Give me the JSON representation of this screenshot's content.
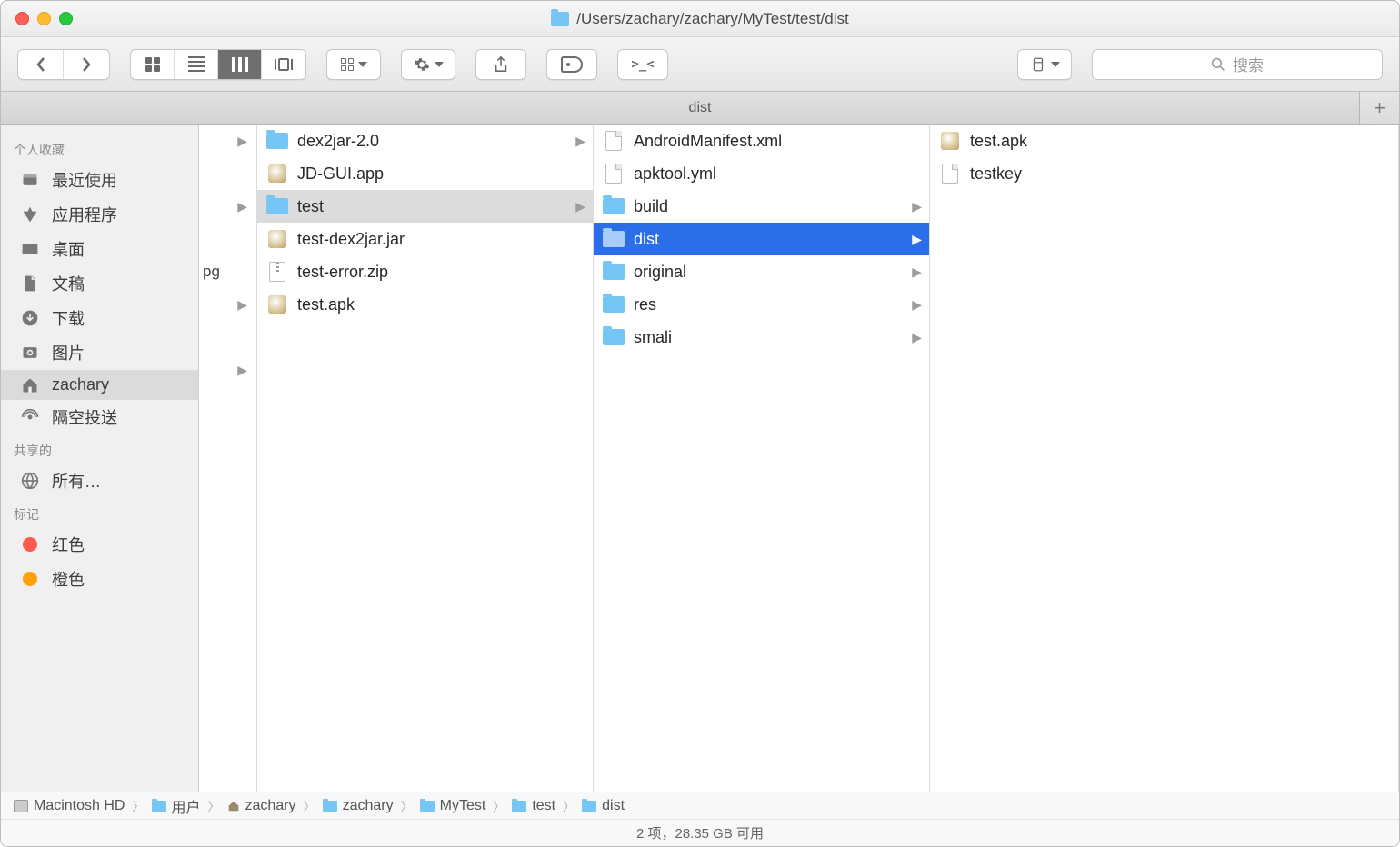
{
  "window": {
    "path": "/Users/zachary/zachary/MyTest/test/dist"
  },
  "tab": {
    "name": "dist"
  },
  "search": {
    "placeholder": "搜索"
  },
  "sidebar": {
    "favorites": {
      "header": "个人收藏",
      "items": [
        {
          "icon": "clock",
          "label": "最近使用"
        },
        {
          "icon": "apps",
          "label": "应用程序"
        },
        {
          "icon": "desktop",
          "label": "桌面"
        },
        {
          "icon": "docs",
          "label": "文稿"
        },
        {
          "icon": "download",
          "label": "下载"
        },
        {
          "icon": "pictures",
          "label": "图片"
        },
        {
          "icon": "home",
          "label": "zachary",
          "selected": true
        },
        {
          "icon": "airdrop",
          "label": "隔空投送"
        }
      ]
    },
    "shared": {
      "header": "共享的",
      "items": [
        {
          "icon": "globe",
          "label": "所有…"
        }
      ]
    },
    "tags": {
      "header": "标记",
      "items": [
        {
          "color": "#ff5a50",
          "label": "红色"
        },
        {
          "color": "#ff9f0a",
          "label": "橙色"
        }
      ]
    }
  },
  "columns": {
    "c0": [
      {
        "t": "arr"
      },
      {
        "t": "empty"
      },
      {
        "t": "arr"
      },
      {
        "t": "empty"
      },
      {
        "t": "pg",
        "label": "pg"
      },
      {
        "t": "arr"
      },
      {
        "t": "empty"
      },
      {
        "t": "arr"
      }
    ],
    "c1": [
      {
        "icon": "folder",
        "name": "dex2jar-2.0",
        "hasChildren": true
      },
      {
        "icon": "jar",
        "name": "JD-GUI.app"
      },
      {
        "icon": "folder",
        "name": "test",
        "hasChildren": true,
        "selected": "g"
      },
      {
        "icon": "jar",
        "name": "test-dex2jar.jar"
      },
      {
        "icon": "zip",
        "name": "test-error.zip"
      },
      {
        "icon": "jar",
        "name": "test.apk"
      }
    ],
    "c2": [
      {
        "icon": "doc",
        "name": "AndroidManifest.xml"
      },
      {
        "icon": "doc",
        "name": "apktool.yml"
      },
      {
        "icon": "folder",
        "name": "build",
        "hasChildren": true
      },
      {
        "icon": "folder",
        "name": "dist",
        "hasChildren": true,
        "selected": "b"
      },
      {
        "icon": "folder",
        "name": "original",
        "hasChildren": true
      },
      {
        "icon": "folder",
        "name": "res",
        "hasChildren": true
      },
      {
        "icon": "folder",
        "name": "smali",
        "hasChildren": true
      }
    ],
    "c3": [
      {
        "icon": "jar",
        "name": "test.apk"
      },
      {
        "icon": "doc",
        "name": "testkey"
      }
    ]
  },
  "pathbar": [
    {
      "icon": "hd",
      "label": "Macintosh HD"
    },
    {
      "icon": "folder",
      "label": "用户"
    },
    {
      "icon": "home",
      "label": "zachary"
    },
    {
      "icon": "folder",
      "label": "zachary"
    },
    {
      "icon": "folder",
      "label": "MyTest"
    },
    {
      "icon": "folder",
      "label": "test"
    },
    {
      "icon": "folder",
      "label": "dist"
    }
  ],
  "status": "2 项，28.35 GB 可用"
}
